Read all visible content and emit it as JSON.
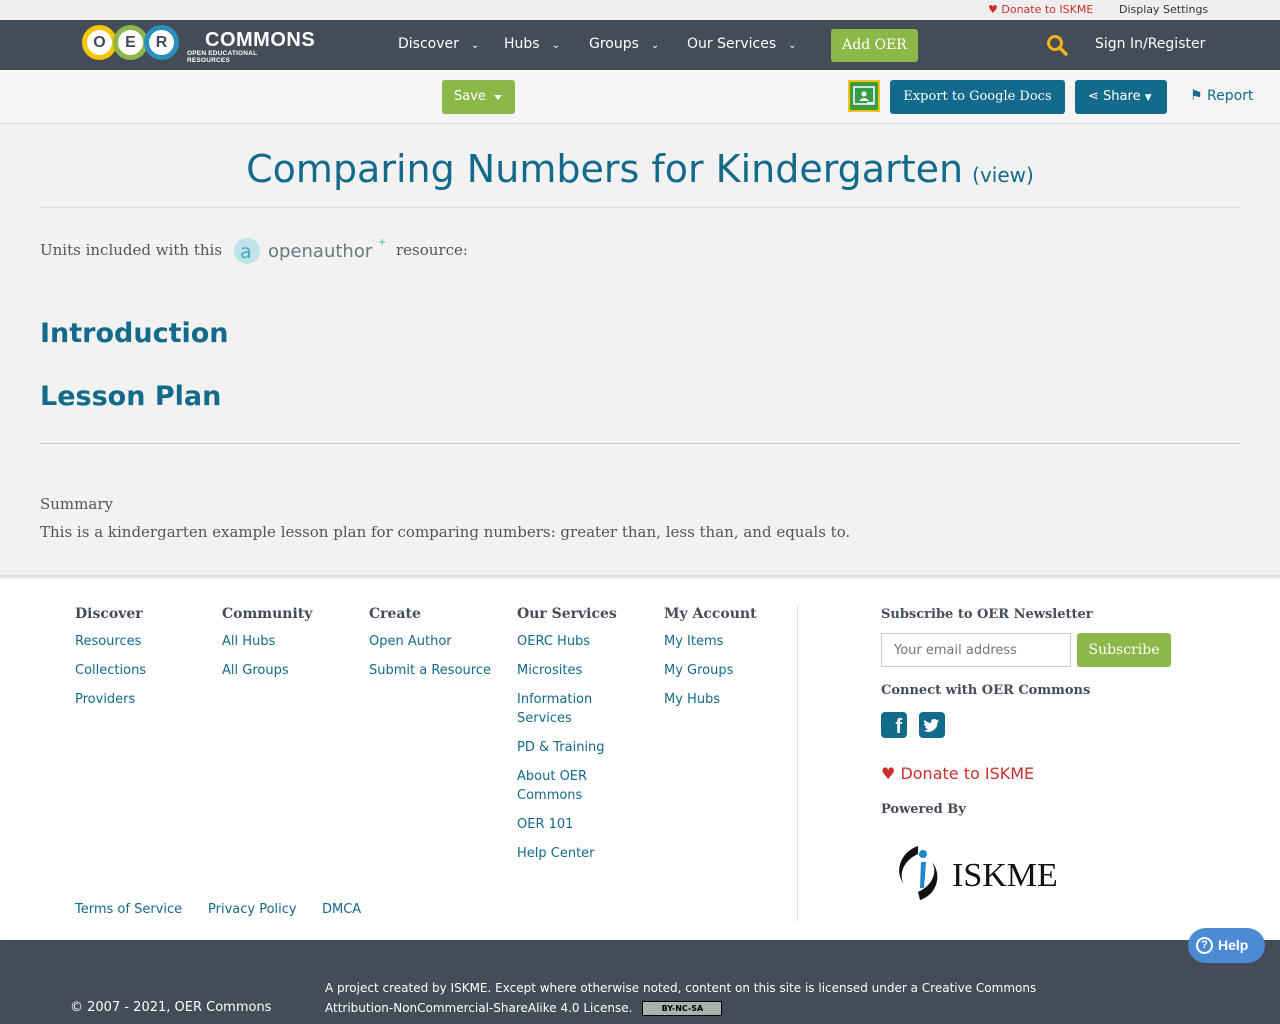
{
  "utility": {
    "donate": "Donate to ISKME",
    "display_settings": "Display Settings"
  },
  "brand": {
    "letters": [
      "O",
      "E",
      "R"
    ],
    "wordmark": "COMMONS",
    "tagline": "OPEN EDUCATIONAL RESOURCES",
    "ring_colors": [
      "#f7c600",
      "#8cb84a",
      "#2a8fbd"
    ]
  },
  "nav": {
    "items": [
      {
        "label": "Discover"
      },
      {
        "label": "Hubs"
      },
      {
        "label": "Groups"
      },
      {
        "label": "Our Services"
      }
    ],
    "add_oer": "Add OER",
    "sign_in": "Sign In/Register"
  },
  "toolbar": {
    "save": "Save",
    "export": "Export to Google Docs",
    "share": "Share",
    "report": "Report"
  },
  "main": {
    "title": "Comparing Numbers for Kindergarten",
    "view": "(view)",
    "units_prefix": "Units included with this",
    "units_suffix": "resource:",
    "openauthor_logo": "openauthor",
    "units": [
      "Introduction",
      "Lesson Plan"
    ],
    "summary_heading": "Summary",
    "summary_text": "This is a kindergarten example lesson plan for comparing numbers: greater than, less than, and equals to."
  },
  "footer": {
    "columns": [
      {
        "heading": "Discover",
        "links": [
          "Resources",
          "Collections",
          "Providers"
        ]
      },
      {
        "heading": "Community",
        "links": [
          "All Hubs",
          "All Groups"
        ]
      },
      {
        "heading": "Create",
        "links": [
          "Open Author",
          "Submit a Resource"
        ]
      },
      {
        "heading": "Our Services",
        "links": [
          "OERC Hubs",
          "Microsites",
          "Information Services",
          "PD & Training",
          "About OER Commons",
          "OER 101",
          "Help Center"
        ]
      },
      {
        "heading": "My Account",
        "links": [
          "My Items",
          "My Groups",
          "My Hubs"
        ]
      }
    ],
    "newsletter_heading": "Subscribe to OER Newsletter",
    "email_placeholder": "Your email address",
    "subscribe": "Subscribe",
    "connect_heading": "Connect with OER Commons",
    "donate": "Donate to ISKME",
    "powered_by": "Powered By",
    "iskme_logo": "ISKME",
    "legal": [
      "Terms of Service",
      "Privacy Policy",
      "DMCA"
    ]
  },
  "bottom": {
    "copyright": "© 2007 - 2021, OER Commons",
    "license": "A project created by ISKME. Except where otherwise noted, content on this site is licensed under a Creative Commons Attribution-NonCommercial-ShareAlike 4.0 License.",
    "cc_badge": "BY-NC-SA"
  },
  "help": "Help",
  "colors": {
    "nav_bg": "#444c57",
    "accent_green": "#8cb84a",
    "link_blue": "#136a8a",
    "donate_red": "#c9302c"
  }
}
